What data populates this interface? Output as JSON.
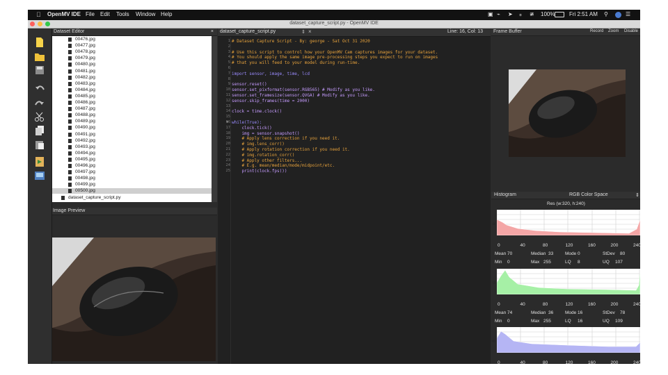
{
  "menubar": {
    "apple": "",
    "app_name": "OpenMV IDE",
    "menus": [
      "File",
      "Edit",
      "Tools",
      "Window",
      "Help"
    ],
    "battery": "100%",
    "clock": "Fri 2:51 AM"
  },
  "window": {
    "title": "dataset_capture_script.py - OpenMV IDE"
  },
  "dataset_editor": {
    "header": "Dataset Editor",
    "close": "×",
    "files": [
      "00476.jpg",
      "00477.jpg",
      "00478.jpg",
      "00479.jpg",
      "00480.jpg",
      "00481.jpg",
      "00482.jpg",
      "00483.jpg",
      "00484.jpg",
      "00485.jpg",
      "00486.jpg",
      "00487.jpg",
      "00488.jpg",
      "00489.jpg",
      "00490.jpg",
      "00491.jpg",
      "00492.jpg",
      "00493.jpg",
      "00494.jpg",
      "00495.jpg",
      "00496.jpg",
      "00497.jpg",
      "00498.jpg",
      "00499.jpg",
      "00500.jpg",
      "dataset_capture_script.py"
    ],
    "selected_file": "00500.jpg",
    "image_preview_header": "Image Preview"
  },
  "editor": {
    "tab_label": "dataset_capture_script.py",
    "tab_arrows": "⇕",
    "tab_close": "×",
    "cursor_position": "Line: 16, Col: 13",
    "lines": [
      {
        "n": "1",
        "t": "# Dataset Capture Script - By: george - Sat Oct 31 2020",
        "c": "c-com"
      },
      {
        "n": "2",
        "t": "",
        "c": ""
      },
      {
        "n": "3",
        "t": "# Use this script to control how your OpenMV Cam captures images for your dataset.",
        "c": "c-com"
      },
      {
        "n": "4",
        "t": "# You should apply the same image pre-processing steps you expect to run on images",
        "c": "c-com"
      },
      {
        "n": "5",
        "t": "# that you will feed to your model during run-time.",
        "c": "c-com"
      },
      {
        "n": "6",
        "t": "",
        "c": ""
      },
      {
        "n": "7",
        "t": "import sensor, image, time, lcd",
        "c": "c-kw"
      },
      {
        "n": "8",
        "t": "",
        "c": ""
      },
      {
        "n": "9",
        "t": "sensor.reset()",
        "c": "c-fn"
      },
      {
        "n": "10",
        "t": "sensor.set_pixformat(sensor.RGB565) # Modify as you like.",
        "c": "c-fn"
      },
      {
        "n": "11",
        "t": "sensor.set_framesize(sensor.QVGA) # Modify as you like.",
        "c": "c-fn"
      },
      {
        "n": "12",
        "t": "sensor.skip_frames(time = 2000)",
        "c": "c-fn"
      },
      {
        "n": "13",
        "t": "",
        "c": ""
      },
      {
        "n": "14",
        "t": "clock = time.clock()",
        "c": "c-fn"
      },
      {
        "n": "15",
        "t": "",
        "c": ""
      },
      {
        "n": "16",
        "t": "while(True):",
        "c": "c-kw"
      },
      {
        "n": "17",
        "t": "    clock.tick()",
        "c": "c-fn"
      },
      {
        "n": "18",
        "t": "    img = sensor.snapshot()",
        "c": "c-fn"
      },
      {
        "n": "19",
        "t": "    # Apply lens correction if you need it.",
        "c": "c-com"
      },
      {
        "n": "20",
        "t": "    # img.lens_corr()",
        "c": "c-com"
      },
      {
        "n": "21",
        "t": "    # Apply rotation correction if you need it.",
        "c": "c-com"
      },
      {
        "n": "22",
        "t": "    # img.rotation_corr()",
        "c": "c-com"
      },
      {
        "n": "23",
        "t": "    # Apply other filters...",
        "c": "c-com"
      },
      {
        "n": "24",
        "t": "    # E.g. mean/median/mode/midpoint/etc.",
        "c": "c-com"
      },
      {
        "n": "25",
        "t": "    print(clock.fps())",
        "c": "c-fn"
      }
    ]
  },
  "frame_buffer": {
    "header": "Frame Buffer",
    "record": "Record",
    "zoom": "Zoom",
    "disable": "Disable"
  },
  "histogram": {
    "header": "Histogram",
    "color_space": "RGB Color Space",
    "resolution": "Res (w:320, h:240)",
    "ticks": [
      "0",
      "40",
      "80",
      "120",
      "160",
      "200",
      "240"
    ],
    "channels": [
      {
        "name": "R",
        "color": "#f4a6a6",
        "stats": {
          "Mean": "70",
          "Median": "33",
          "Mode": "0",
          "StDev": "80",
          "Min": "0",
          "Max": "255",
          "LQ": "8",
          "UQ": "107"
        }
      },
      {
        "name": "G",
        "color": "#a6f0a6",
        "stats": {
          "Mean": "74",
          "Median": "36",
          "Mode": "16",
          "StDev": "78",
          "Min": "0",
          "Max": "255",
          "LQ": "16",
          "UQ": "109"
        }
      },
      {
        "name": "B",
        "color": "#b5b5f4",
        "stats": null
      }
    ]
  }
}
